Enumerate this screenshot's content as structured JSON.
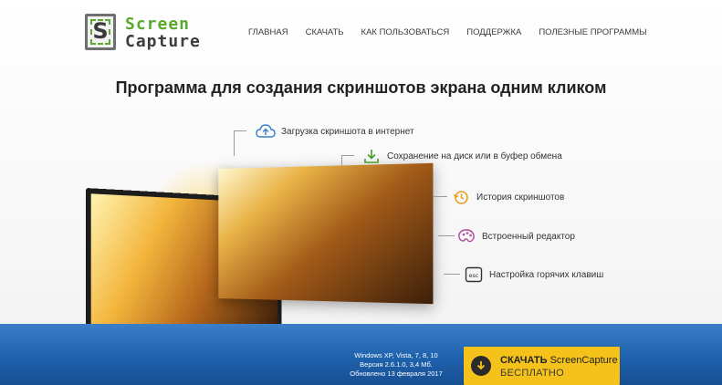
{
  "header": {
    "logo": {
      "letter": "S",
      "line1": "Screen",
      "line2": "Capture"
    },
    "nav": [
      {
        "label": "ГЛАВНАЯ"
      },
      {
        "label": "СКАЧАТЬ"
      },
      {
        "label": "КАК ПОЛЬЗОВАТЬСЯ"
      },
      {
        "label": "ПОДДЕРЖКА"
      },
      {
        "label": "ПОЛЕЗНЫЕ ПРОГРАММЫ"
      }
    ]
  },
  "main": {
    "title": "Программа для создания скриншотов экрана одним кликом",
    "features": [
      {
        "icon": "cloud-upload-icon",
        "label": "Загрузка скриншота в интернет"
      },
      {
        "icon": "download-icon",
        "label": "Сохранение на диск или в буфер обмена"
      },
      {
        "icon": "history-icon",
        "label": "История скриншотов"
      },
      {
        "icon": "palette-icon",
        "label": "Встроенный редактор"
      },
      {
        "icon": "esc-key-icon",
        "label": "Настройка горячих клавиш"
      }
    ]
  },
  "footer": {
    "sysinfo": {
      "os": "Windows XP, Vista, 7, 8, 10",
      "version": "Версия 2.6.1.0, 3,4 Мб.",
      "updated": "Обновлено 13 февраля 2017"
    },
    "download": {
      "action": "СКАЧАТЬ",
      "product": "ScreenCapture",
      "price": "БЕСПЛАТНО"
    }
  },
  "colors": {
    "brand_green": "#5aa82c",
    "band_blue": "#1f62ad",
    "button_yellow": "#f5c21b",
    "accent_orange": "#e8a020"
  }
}
